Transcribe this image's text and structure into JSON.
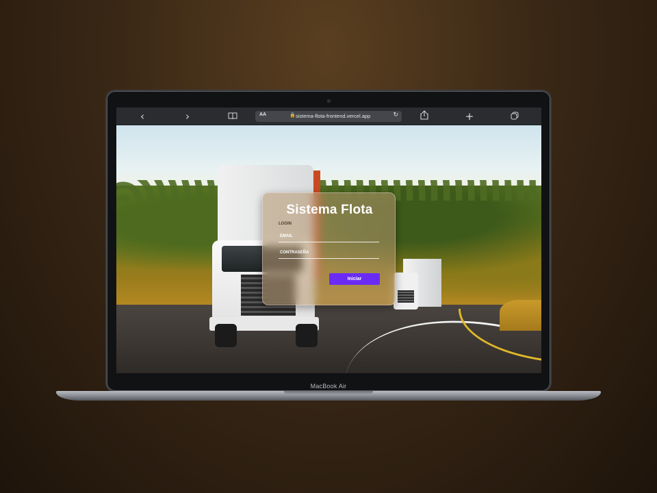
{
  "browser": {
    "url": "sistema-flota-frontend.vercel.app",
    "text_size_label": "AA",
    "icons": [
      "back-icon",
      "forward-icon",
      "bookmarks-icon",
      "lock-icon",
      "reload-icon",
      "share-icon",
      "new-tab-icon",
      "tabs-icon"
    ]
  },
  "login": {
    "title": "Sistema Flota",
    "subtitle": "LOGIN",
    "email_label": "EMAIL",
    "password_label": "CONTRASEÑA",
    "submit_label": "Iniciar"
  },
  "device": {
    "label": "MacBook Air"
  },
  "colors": {
    "button": "#6a2cf5",
    "background": "#3a2816"
  }
}
